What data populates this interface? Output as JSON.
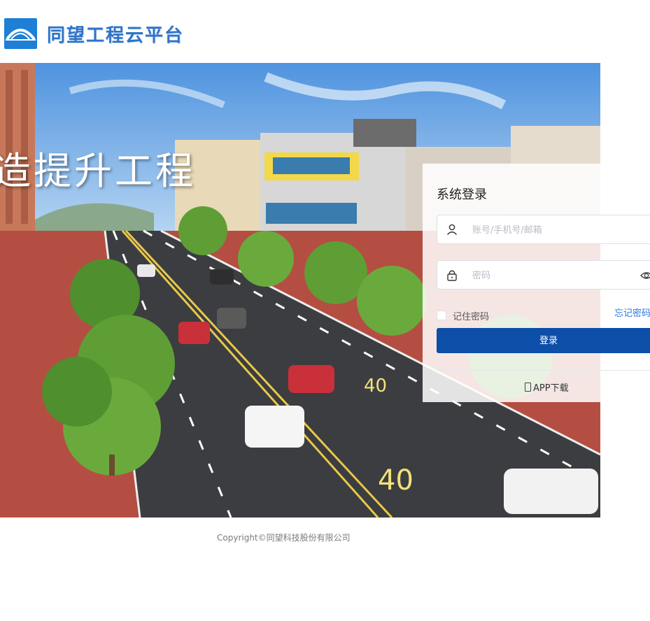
{
  "header": {
    "logo_text": "同望工程云平台"
  },
  "hero": {
    "slogan": "造提升工程"
  },
  "login": {
    "title": "系统登录",
    "account_placeholder": "账号/手机号/邮箱",
    "password_placeholder": "密码",
    "remember_label": "记住密码",
    "forgot_label": "忘记密码",
    "submit_label": "登录",
    "app_download_label": "APP下载"
  },
  "footer": {
    "copyright": "Copyright©同望科技股份有限公司"
  },
  "colors": {
    "brand_blue": "#1e7fd6",
    "button_blue": "#0d4ea8",
    "link_blue": "#2a7ae2"
  },
  "icons": {
    "user": "user-icon",
    "lock": "lock-icon",
    "eye": "eye-icon",
    "phone": "phone-icon",
    "logo": "bridge-logo-icon"
  }
}
